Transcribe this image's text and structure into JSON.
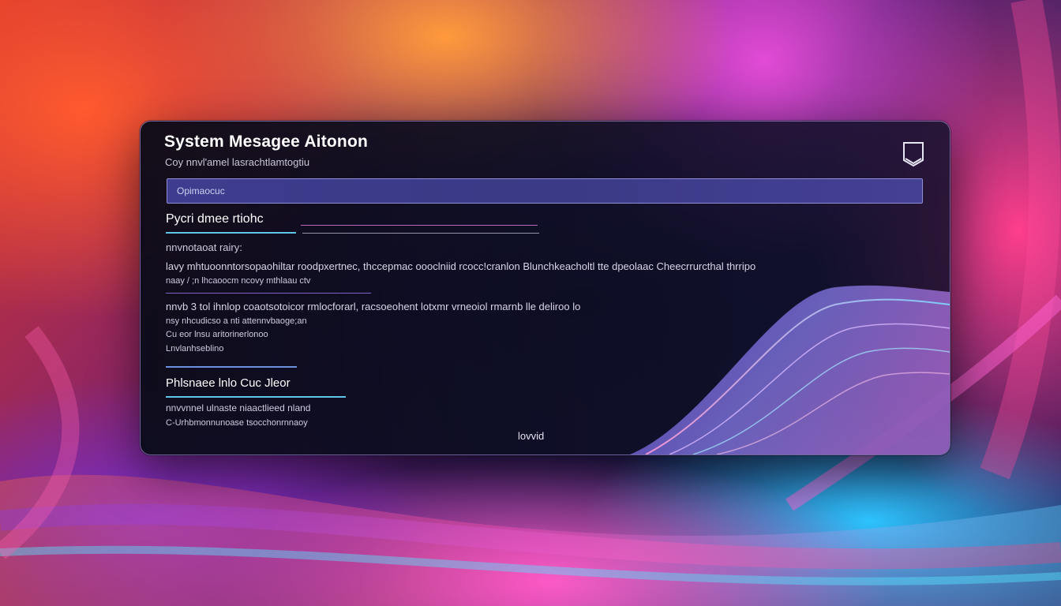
{
  "window": {
    "title": "System Mesagee  Aitonon",
    "subtitle": "Coy nnvl'amel lasrachtlamtogtiu"
  },
  "search": {
    "placeholder": "Opimaocuc"
  },
  "section1": {
    "heading": "Pycri dmee rtiohc",
    "label": "nnvnotaoat rairy:",
    "paragraph_line1": "lavy mhtuoonntorsopaohiltar roodpxertnec, thccepmac oooclniid rcocc!cranlon Blunchkeacholtl tte dpeolaac Cheecrrurcthal thrripo",
    "paragraph_line2": "naay / ;n   lhcaoocm ncovy mthlaau ctv",
    "item_line1": "nnvb 3   tol ihnlop coaotsotoicor rmlocforarl, racsoeohent lotxmr vrneoiol rmarnb lle deliroo lo",
    "item_line2": "nsy nhcudicso a  nti attennvbaoge;an",
    "item_line3": "Cu eor lnsu aritorinerlonoo",
    "item_line4": "Lnvlanhseblino"
  },
  "section2": {
    "heading": "Phlsnaee lnlo Cuc Jleor",
    "line1": "nnvvnnel ulnaste niaactlieed nland",
    "line2": "C-Urhbmonnunoase tsocchonrnnaoy"
  },
  "footer": {
    "label": "lovvid"
  },
  "colors": {
    "panel_border": "#bea9ff",
    "search_fill": "#3e3c8e",
    "underline_cyan": "#5fc6ea",
    "underline_violet": "#9b7bf0",
    "underline_pink": "#e47fe0"
  },
  "icons": {
    "close": "shield-chevron-icon"
  }
}
